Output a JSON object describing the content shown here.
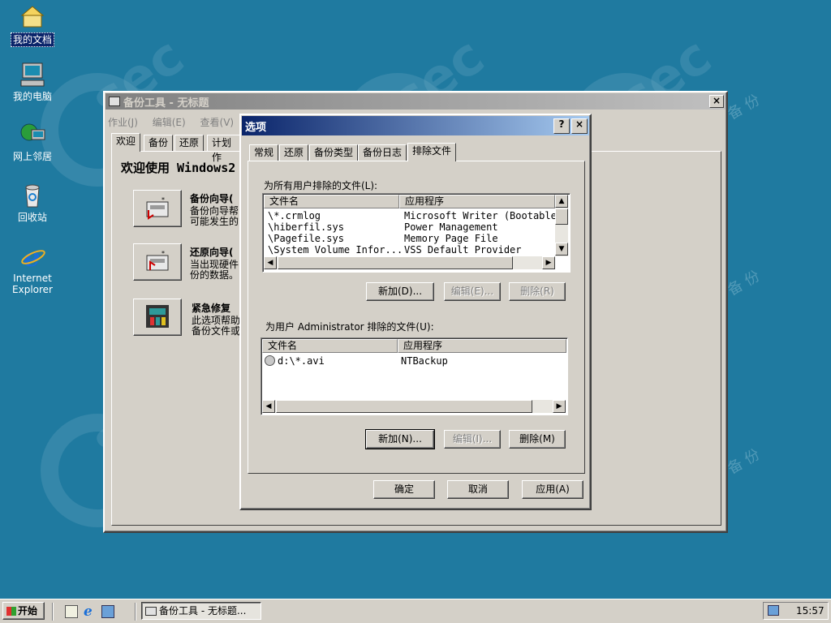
{
  "desktop": {
    "icons": [
      {
        "label": "我的文档"
      },
      {
        "label": "我的电脑"
      },
      {
        "label": "网上邻居"
      },
      {
        "label": "回收站"
      },
      {
        "label": "Internet Explorer"
      }
    ],
    "watermark_text": "sec",
    "watermark_sub": "备 份"
  },
  "backup_window": {
    "title": "备份工具 - 无标题",
    "menu": [
      "作业(J)",
      "编辑(E)",
      "查看(V)"
    ],
    "tabs": [
      "欢迎",
      "备份",
      "还原",
      "计划作"
    ],
    "heading": "欢迎使用 Windows2",
    "wizards": [
      {
        "title": "备份向导(",
        "desc1": "备份向导帮",
        "desc2": "可能发生的"
      },
      {
        "title": "还原向导(",
        "desc1": "当出现硬件",
        "desc2": "份的数据。"
      },
      {
        "title": "紧急修复",
        "desc1": "此选项帮助",
        "desc2": "备份文件或"
      }
    ]
  },
  "options_dialog": {
    "title": "选项",
    "help_glyph": "?",
    "close_glyph": "×",
    "tabs": [
      "常规",
      "还原",
      "备份类型",
      "备份日志",
      "排除文件"
    ],
    "active_tab": "排除文件",
    "all_users": {
      "label": "为所有用户排除的文件(L):",
      "columns": [
        "文件名",
        "应用程序"
      ],
      "rows": [
        {
          "file": "\\*.crmlog",
          "app": "Microsoft Writer (Bootable"
        },
        {
          "file": "\\hiberfil.sys",
          "app": "Power Management"
        },
        {
          "file": "\\Pagefile.sys",
          "app": "Memory Page File"
        },
        {
          "file": "\\System Volume Infor...",
          "app": "VSS Default Provider"
        }
      ],
      "buttons": {
        "add": "新加(D)...",
        "edit": "编辑(E)...",
        "delete": "删除(R)"
      }
    },
    "user": {
      "label": "为用户 Administrator 排除的文件(U):",
      "columns": [
        "文件名",
        "应用程序"
      ],
      "rows": [
        {
          "file": "d:\\*.avi",
          "app": "NTBackup"
        }
      ],
      "buttons": {
        "add": "新加(N)...",
        "edit": "编辑(I)...",
        "delete": "删除(M)"
      }
    },
    "footer": {
      "ok": "确定",
      "cancel": "取消",
      "apply": "应用(A)"
    }
  },
  "taskbar": {
    "start": "开始",
    "task": "备份工具 - 无标题...",
    "clock": "15:57"
  }
}
